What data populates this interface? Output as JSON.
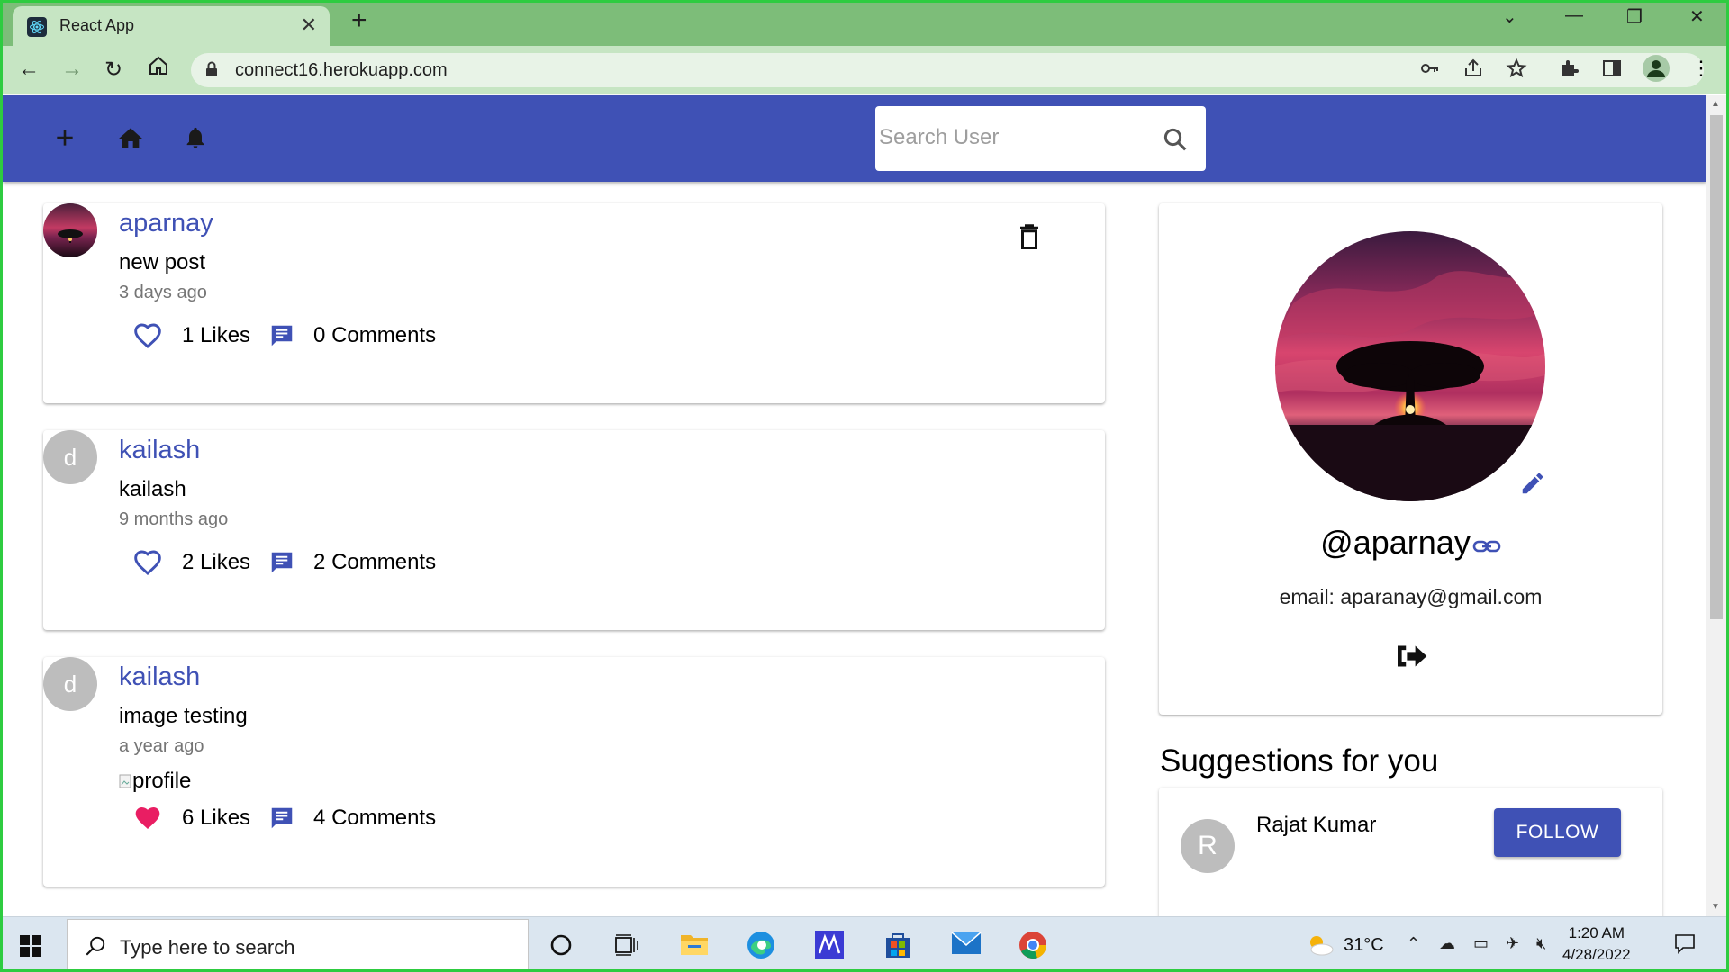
{
  "browser": {
    "tab_title": "React App",
    "url": "connect16.herokuapp.com"
  },
  "header": {
    "search_placeholder": "Search User"
  },
  "posts": [
    {
      "username": "aparnay",
      "avatar_letter": "",
      "text": "new post",
      "time": "3 days ago",
      "likes": "1 Likes",
      "comments": "0 Comments",
      "liked": false,
      "can_delete": true
    },
    {
      "username": "kailash",
      "avatar_letter": "d",
      "text": "kailash",
      "time": "9 months ago",
      "likes": "2 Likes",
      "comments": "2 Comments",
      "liked": false,
      "can_delete": false
    },
    {
      "username": "kailash",
      "avatar_letter": "d",
      "text": "image testing",
      "time": "a year ago",
      "image_alt": "profile",
      "likes": "6 Likes",
      "comments": "4 Comments",
      "liked": true,
      "can_delete": false
    }
  ],
  "profile": {
    "handle": "@aparnay",
    "email": "email: aparanay@gmail.com"
  },
  "suggestions": {
    "title": "Suggestions for you",
    "items": [
      {
        "avatar_letter": "R",
        "name": "Rajat Kumar",
        "button": "FOLLOW"
      }
    ]
  },
  "taskbar": {
    "search_text": "Type here to search",
    "temperature": "31°C",
    "time": "1:20 AM",
    "date": "4/28/2022"
  },
  "colors": {
    "primary": "#3f51b5",
    "like_active": "#e91e63"
  }
}
